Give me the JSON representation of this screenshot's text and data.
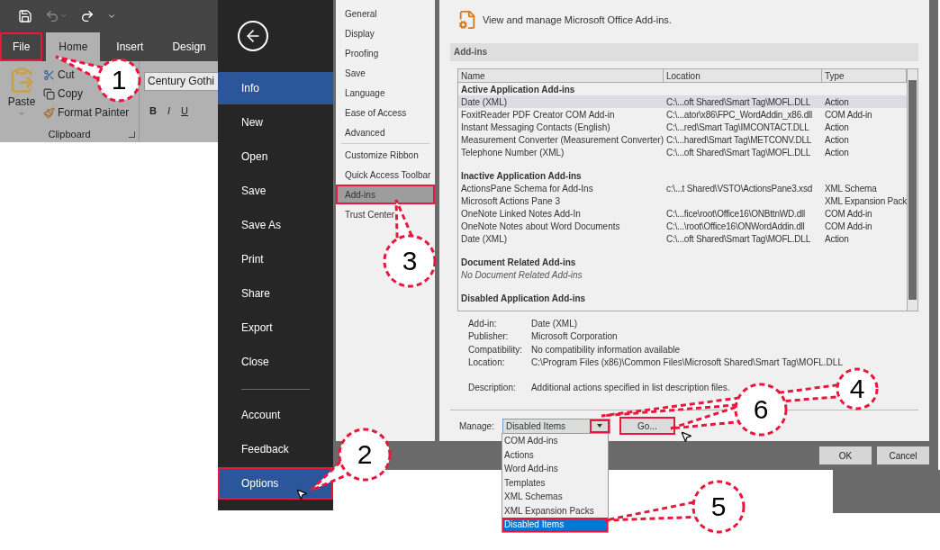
{
  "word_window": {
    "tabs": [
      {
        "label": "File",
        "selected": false,
        "marked": true
      },
      {
        "label": "Home",
        "selected": true,
        "marked": false
      },
      {
        "label": "Insert",
        "selected": false,
        "marked": false
      },
      {
        "label": "Design",
        "selected": false,
        "marked": false
      }
    ],
    "clipboard": {
      "paste": "Paste",
      "items": [
        "Cut",
        "Copy",
        "Format Painter"
      ],
      "group_label": "Clipboard"
    },
    "font": {
      "name": "Century Gothi",
      "format_buttons": [
        "B",
        "I",
        "U"
      ]
    }
  },
  "backstage": {
    "items": [
      {
        "label": "Info",
        "selected": true,
        "marked": false
      },
      {
        "label": "New",
        "selected": false,
        "marked": false
      },
      {
        "label": "Open",
        "selected": false,
        "marked": false
      },
      {
        "label": "Save",
        "selected": false,
        "marked": false
      },
      {
        "label": "Save As",
        "selected": false,
        "marked": false
      },
      {
        "label": "Print",
        "selected": false,
        "marked": false
      },
      {
        "label": "Share",
        "selected": false,
        "marked": false
      },
      {
        "label": "Export",
        "selected": false,
        "marked": false
      },
      {
        "label": "Close",
        "selected": false,
        "marked": false
      }
    ],
    "bottom_items": [
      {
        "label": "Account",
        "selected": false,
        "marked": false
      },
      {
        "label": "Feedback",
        "selected": false,
        "marked": false
      },
      {
        "label": "Options",
        "selected": true,
        "marked": true
      }
    ]
  },
  "options_dialog": {
    "categories": [
      {
        "label": "General",
        "selected": false,
        "marked": false
      },
      {
        "label": "Display",
        "selected": false,
        "marked": false
      },
      {
        "label": "Proofing",
        "selected": false,
        "marked": false
      },
      {
        "label": "Save",
        "selected": false,
        "marked": false
      },
      {
        "label": "Language",
        "selected": false,
        "marked": false
      },
      {
        "label": "Ease of Access",
        "selected": false,
        "marked": false
      },
      {
        "label": "Advanced",
        "selected": false,
        "marked": false
      }
    ],
    "more_categories": [
      {
        "label": "Customize Ribbon",
        "selected": false,
        "marked": false
      },
      {
        "label": "Quick Access Toolbar",
        "selected": false,
        "marked": false
      },
      {
        "label": "Add-ins",
        "selected": true,
        "marked": true
      },
      {
        "label": "Trust Center",
        "selected": false,
        "marked": false
      }
    ],
    "header": "View and manage Microsoft Office Add-ins.",
    "section": "Add-ins",
    "table": {
      "columns": [
        "Name",
        "Location",
        "Type"
      ],
      "groups": [
        {
          "title": "Active Application Add-ins",
          "rows": [
            {
              "name": "Date (XML)",
              "location": "C:\\...oft Shared\\Smart Tag\\MOFL.DLL",
              "type": "Action",
              "selected": true
            },
            {
              "name": "FoxitReader PDF Creator COM Add-in",
              "location": "C:\\...ator\\x86\\FPC_WordAddin_x86.dll",
              "type": "COM Add-in",
              "selected": false
            },
            {
              "name": "Instant Messaging Contacts (English)",
              "location": "C:\\...red\\Smart Tag\\IMCONTACT.DLL",
              "type": "Action",
              "selected": false
            },
            {
              "name": "Measurement Converter (Measurement Converter)",
              "location": "C:\\...hared\\Smart Tag\\METCONV.DLL",
              "type": "Action",
              "selected": false
            },
            {
              "name": "Telephone Number (XML)",
              "location": "C:\\...oft Shared\\Smart Tag\\MOFL.DLL",
              "type": "Action",
              "selected": false
            }
          ]
        },
        {
          "title": "Inactive Application Add-ins",
          "rows": [
            {
              "name": "ActionsPane Schema for Add-Ins",
              "location": "c:\\...t Shared\\VSTO\\ActionsPane3.xsd",
              "type": "XML Schema",
              "selected": false
            },
            {
              "name": "Microsoft Actions Pane 3",
              "location": "",
              "type": "XML Expansion Pack",
              "selected": false
            },
            {
              "name": "OneNote Linked Notes Add-In",
              "location": "C:\\...fice\\root\\Office16\\ONBttnWD.dll",
              "type": "COM Add-in",
              "selected": false
            },
            {
              "name": "OneNote Notes about Word Documents",
              "location": "C:\\...\\root\\Office16\\ONWordAddin.dll",
              "type": "COM Add-in",
              "selected": false
            },
            {
              "name": "Date (XML)",
              "location": "C:\\...oft Shared\\Smart Tag\\MOFL.DLL",
              "type": "Action",
              "selected": false
            }
          ]
        },
        {
          "title": "Document Related Add-ins",
          "empty": "No Document Related Add-ins"
        },
        {
          "title": "Disabled Application Add-ins"
        }
      ]
    },
    "details": [
      {
        "label": "Add-in:",
        "value": "Date (XML)"
      },
      {
        "label": "Publisher:",
        "value": "Microsoft Corporation"
      },
      {
        "label": "Compatibility:",
        "value": "No compatibility information available"
      },
      {
        "label": "Location:",
        "value": "C:\\Program Files (x86)\\Common Files\\Microsoft Shared\\Smart Tag\\MOFL.DLL"
      },
      {
        "label": "Description:",
        "value": "Additional actions specified in list description files."
      }
    ],
    "manage": {
      "label": "Manage:",
      "value": "Disabled Items",
      "go": "Go...",
      "options": [
        {
          "label": "COM Add-ins",
          "selected": false
        },
        {
          "label": "Actions",
          "selected": false
        },
        {
          "label": "Word Add-ins",
          "selected": false
        },
        {
          "label": "Templates",
          "selected": false
        },
        {
          "label": "XML Schemas",
          "selected": false
        },
        {
          "label": "XML Expansion Packs",
          "selected": false
        },
        {
          "label": "Disabled Items",
          "selected": true
        }
      ]
    },
    "buttons": [
      "OK",
      "Cancel"
    ]
  },
  "callouts": [
    "1",
    "2",
    "3",
    "4",
    "5",
    "6"
  ]
}
